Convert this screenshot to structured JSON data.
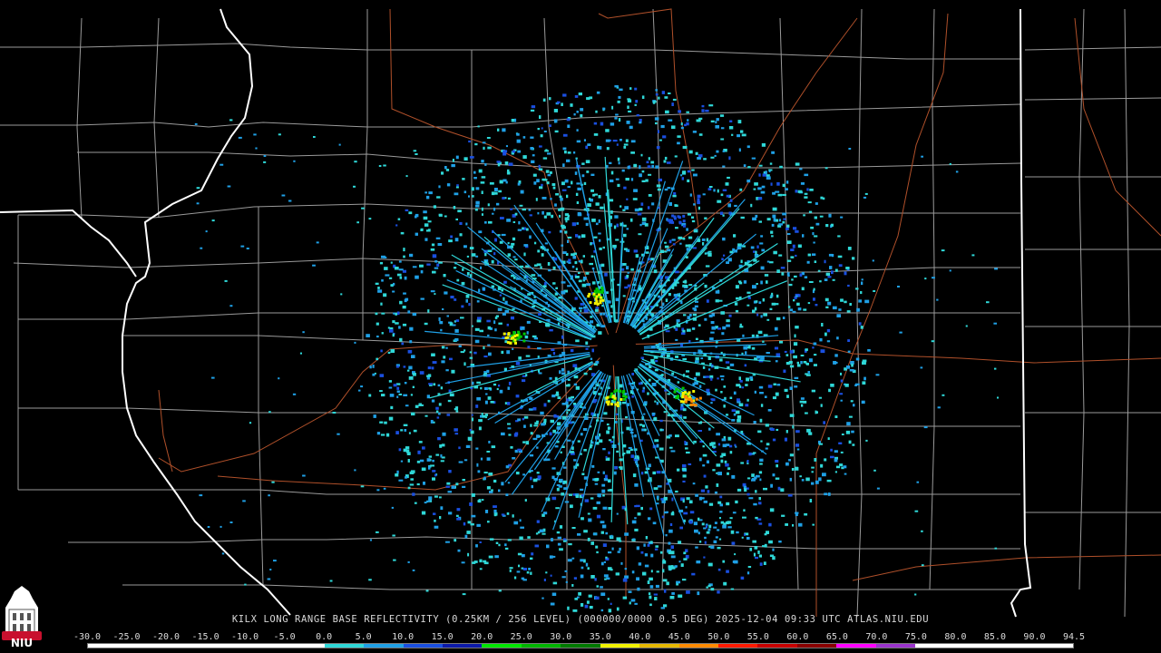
{
  "product": {
    "caption": "KILX LONG RANGE BASE REFLECTIVITY (0.25KM / 256 LEVEL) (000000/0000 0.5 DEG) 2025-12-04 09:33 UTC  ATLAS.NIU.EDU"
  },
  "logo": {
    "text": "NIU",
    "color": "#c8102e"
  },
  "colorbar": {
    "labels": [
      "-30.0",
      "-25.0",
      "-20.0",
      "-15.0",
      "-10.0",
      "-5.0",
      "0.0",
      "5.0",
      "10.0",
      "15.0",
      "20.0",
      "25.0",
      "30.0",
      "35.0",
      "40.0",
      "45.0",
      "50.0",
      "55.0",
      "60.0",
      "65.0",
      "70.0",
      "75.0",
      "80.0",
      "85.0",
      "90.0",
      "94.5"
    ],
    "colors": [
      "#ffffff",
      "#ffffff",
      "#ffffff",
      "#ffffff",
      "#ffffff",
      "#ffffff",
      "#2fd8d8",
      "#1fa0e6",
      "#1a4fe0",
      "#0c1aa8",
      "#00e600",
      "#00b400",
      "#007a00",
      "#f2f200",
      "#e6b800",
      "#ff8a00",
      "#ff1a00",
      "#c80000",
      "#8a0000",
      "#ff00ff",
      "#9a33cc",
      "#ffffff",
      "#ffffff",
      "#ffffff",
      "#ffffff"
    ]
  },
  "map": {
    "background": "#000000",
    "county_line_color": "#9a9a9a",
    "state_line_color": "#ffffff",
    "highway_color": "#b0502a",
    "radar": {
      "site": "KILX"
    }
  }
}
